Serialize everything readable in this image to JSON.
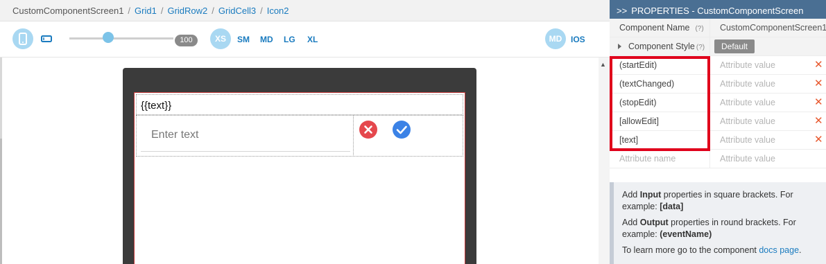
{
  "breadcrumb": [
    {
      "label": "CustomComponentScreen1"
    },
    {
      "label": "Grid1"
    },
    {
      "label": "GridRow2"
    },
    {
      "label": "GridCell3"
    },
    {
      "label": "Icon2"
    }
  ],
  "toolbar": {
    "zoom": "100",
    "sizes": [
      "XS",
      "SM",
      "MD",
      "LG",
      "XL"
    ],
    "platform_md": "MD",
    "platform_ios": "IOS",
    "icons": [
      "phone-portrait-icon",
      "phone-landscape-icon"
    ]
  },
  "canvas": {
    "text_binding": "{{text}}",
    "input_placeholder": "Enter text",
    "icons": [
      "cancel-icon",
      "check-icon"
    ]
  },
  "panel": {
    "header": "PROPERTIES - CustomComponentScreen",
    "component_name_label": "Component Name",
    "component_name_help": "(?)",
    "component_name_value": "CustomComponentScreen1",
    "component_style_label": "Component Style",
    "component_style_help": "(?)",
    "component_style_value": "Default",
    "attributes": [
      {
        "name": "(startEdit)",
        "value": "Attribute value"
      },
      {
        "name": "(textChanged)",
        "value": "Attribute value"
      },
      {
        "name": "(stopEdit)",
        "value": "Attribute value"
      },
      {
        "name": "[allowEdit]",
        "value": "Attribute value"
      },
      {
        "name": "[text]",
        "value": "Attribute value"
      }
    ],
    "new_attr_name": "Attribute name",
    "new_attr_value": "Attribute value",
    "delete_symbol": "✕",
    "info": {
      "line1_pre": "Add ",
      "line1_bold": "Input",
      "line1_post": " properties in square brackets. For example: ",
      "line1_example": "[data]",
      "line2_pre": "Add ",
      "line2_bold": "Output",
      "line2_post": " properties in round brackets. For example: ",
      "line2_example": "(eventName)",
      "line3_pre": "To learn more go to the component ",
      "line3_link": "docs page",
      "line3_post": "."
    }
  },
  "colors": {
    "panel_header": "#4a6f93",
    "highlight_box": "#e0001b",
    "delete_x": "#e8592f",
    "link": "#1a7bbf"
  }
}
